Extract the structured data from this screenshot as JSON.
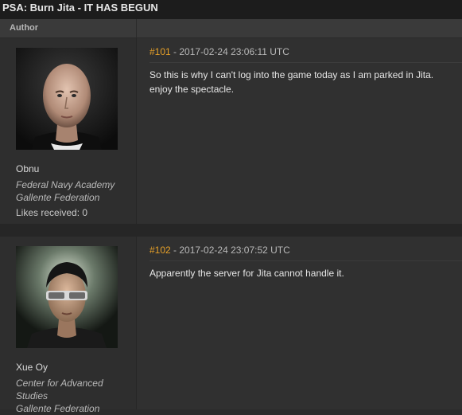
{
  "thread": {
    "title": "PSA: Burn Jita - IT HAS BEGUN"
  },
  "header": {
    "author_label": "Author"
  },
  "posts": [
    {
      "author": "Obnu",
      "corp": "Federal Navy Academy",
      "alliance": "Gallente Federation",
      "likes": "Likes received: 0",
      "number": "#101",
      "timestamp": " - 2017-02-24 23:06:11 UTC",
      "text": "So this is why I can't log into the game today as I am parked in Jita. \nenjoy the spectacle."
    },
    {
      "author": "Xue Oy",
      "corp": "Center for Advanced Studies",
      "alliance": "Gallente Federation",
      "number": "#102",
      "timestamp": " - 2017-02-24 23:07:52 UTC",
      "text": "Apparently the server for Jita cannot handle it."
    }
  ],
  "colors": {
    "post_number": "#e8a128",
    "background": "#2b2b2b"
  }
}
